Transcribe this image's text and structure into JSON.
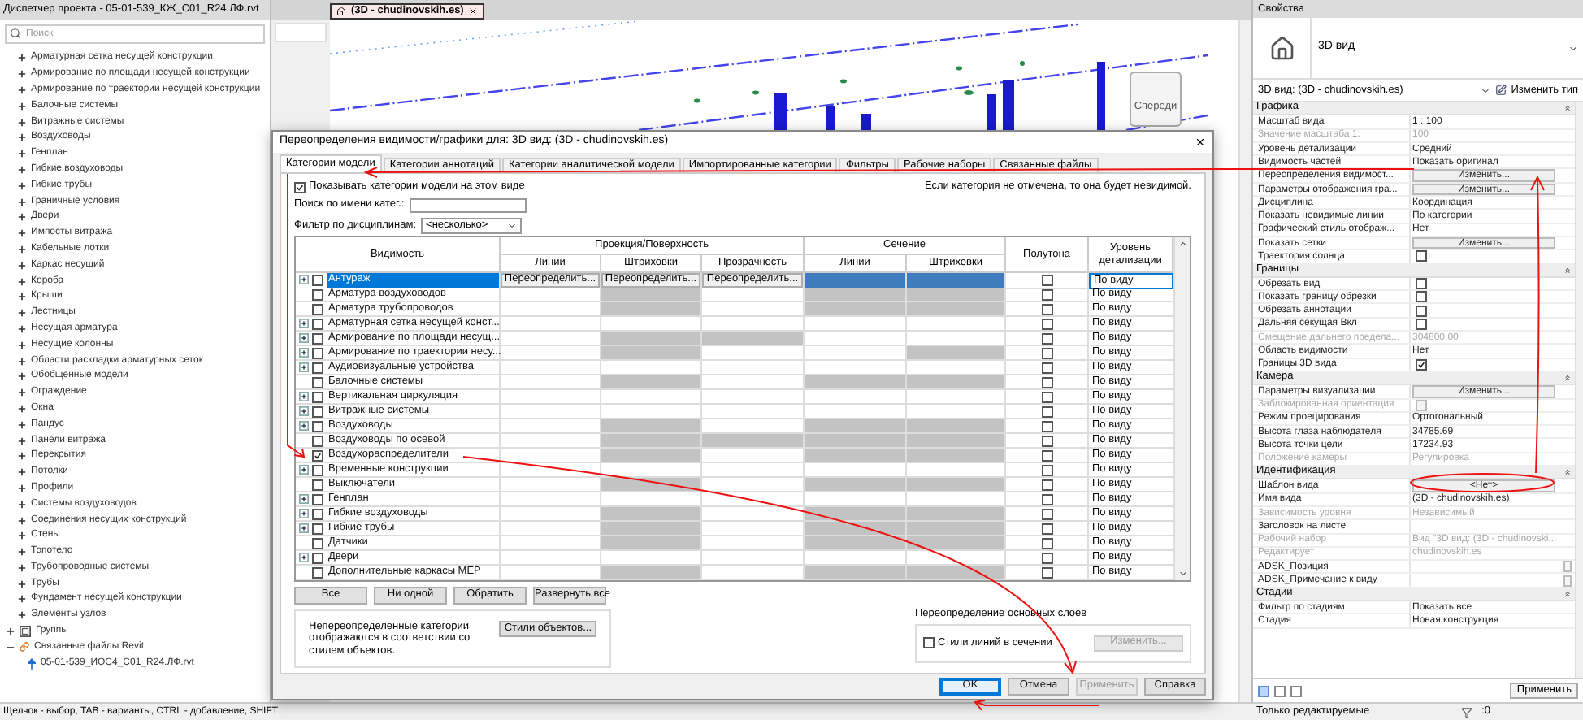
{
  "left_panel": {
    "title": "Диспетчер проекта - 05-01-539_КЖ_С01_R24.ЛФ.rvt",
    "search": {
      "placeholder": "Поиск"
    },
    "tree": [
      {
        "label": "Арматурная сетка несущей конструкции",
        "kind": "category",
        "expanded": false
      },
      {
        "label": "Армирование по площади несущей конструкции",
        "kind": "category",
        "expanded": false
      },
      {
        "label": "Армирование по траектории несущей конструкции",
        "kind": "category",
        "expanded": false
      },
      {
        "label": "Балочные системы",
        "kind": "category",
        "expanded": false
      },
      {
        "label": "Витражные системы",
        "kind": "category",
        "expanded": false
      },
      {
        "label": "Воздуховоды",
        "kind": "category",
        "expanded": false
      },
      {
        "label": "Генплан",
        "kind": "category",
        "expanded": false
      },
      {
        "label": "Гибкие воздуховоды",
        "kind": "category",
        "expanded": false
      },
      {
        "label": "Гибкие трубы",
        "kind": "category",
        "expanded": false
      },
      {
        "label": "Граничные условия",
        "kind": "category",
        "expanded": false
      },
      {
        "label": "Двери",
        "kind": "category",
        "expanded": false
      },
      {
        "label": "Импосты витража",
        "kind": "category",
        "expanded": false
      },
      {
        "label": "Кабельные лотки",
        "kind": "category",
        "expanded": false
      },
      {
        "label": "Каркас несущий",
        "kind": "category",
        "expanded": false
      },
      {
        "label": "Короба",
        "kind": "category",
        "expanded": false
      },
      {
        "label": "Крыши",
        "kind": "category",
        "expanded": false
      },
      {
        "label": "Лестницы",
        "kind": "category",
        "expanded": false
      },
      {
        "label": "Несущая арматура",
        "kind": "category",
        "expanded": false
      },
      {
        "label": "Несущие колонны",
        "kind": "category",
        "expanded": false
      },
      {
        "label": "Области раскладки арматурных сеток",
        "kind": "category",
        "expanded": false
      },
      {
        "label": "Обобщенные модели",
        "kind": "category",
        "expanded": false
      },
      {
        "label": "Ограждение",
        "kind": "category",
        "expanded": false
      },
      {
        "label": "Окна",
        "kind": "category",
        "expanded": false
      },
      {
        "label": "Пандус",
        "kind": "category",
        "expanded": false
      },
      {
        "label": "Панели витража",
        "kind": "category",
        "expanded": false
      },
      {
        "label": "Перекрытия",
        "kind": "category",
        "expanded": false
      },
      {
        "label": "Потолки",
        "kind": "category",
        "expanded": false
      },
      {
        "label": "Профили",
        "kind": "category",
        "expanded": false
      },
      {
        "label": "Системы воздуховодов",
        "kind": "category",
        "expanded": false
      },
      {
        "label": "Соединения несущих конструкций",
        "kind": "category",
        "expanded": false
      },
      {
        "label": "Стены",
        "kind": "category",
        "expanded": false
      },
      {
        "label": "Топотело",
        "kind": "category",
        "expanded": false
      },
      {
        "label": "Трубопроводные системы",
        "kind": "category",
        "expanded": false
      },
      {
        "label": "Трубы",
        "kind": "category",
        "expanded": false
      },
      {
        "label": "Фундамент несущей конструкции",
        "kind": "category",
        "expanded": false
      },
      {
        "label": "Элементы узлов",
        "kind": "category",
        "expanded": false
      },
      {
        "label": "Группы",
        "kind": "group",
        "expanded": false
      },
      {
        "label": "Связанные файлы Revit",
        "kind": "links",
        "expanded": true,
        "children": [
          {
            "label": "05-01-539_ИОС4_С01_R24.ЛФ.rvt",
            "kind": "file"
          }
        ]
      }
    ]
  },
  "view": {
    "tab": "(3D - chudinovskih.es)",
    "cube_label": "Спереди"
  },
  "dialog": {
    "title": "Переопределения видимости/графики для: 3D вид: (3D - chudinovskih.es)",
    "tabs": [
      {
        "label": "Категории модели",
        "selected": true
      },
      {
        "label": "Категории аннотаций",
        "selected": false
      },
      {
        "label": "Категории аналитической модели",
        "selected": false
      },
      {
        "label": "Импортированные категории",
        "selected": false
      },
      {
        "label": "Фильтры",
        "selected": false
      },
      {
        "label": "Рабочие наборы",
        "selected": false
      },
      {
        "label": "Связанные файлы",
        "selected": false
      }
    ],
    "show_categories": {
      "label": "Показывать категории модели на этом виде",
      "checked": true
    },
    "hint": "Если категория не отмечена, то она будет невидимой.",
    "search": {
      "label": "Поиск по имени катег.:"
    },
    "discipline": {
      "label": "Фильтр по дисциплинам:",
      "value": "<несколько>"
    },
    "table": {
      "visibility_header": "Видимость",
      "projection_header": "Проекция/Поверхность",
      "projection_columns": [
        "Линии",
        "Штриховки",
        "Прозрачность"
      ],
      "section_header": "Сечение",
      "section_columns": [
        "Линии",
        "Штриховки"
      ],
      "halftone_header": "Полутона",
      "detail_header": "Уровень детализации",
      "rows": [
        {
          "name": "Антураж",
          "expandable": true,
          "visible": false,
          "selected": true,
          "greyed": [
            false,
            false,
            false,
            true,
            true
          ],
          "overrides": [
            "Переопределить...",
            "Переопределить...",
            "Переопределить..."
          ],
          "halftone": false,
          "detail": "По виду"
        },
        {
          "name": "Арматура воздуховодов",
          "expandable": false,
          "visible": false,
          "selected": false,
          "greyed": [
            false,
            true,
            false,
            true,
            true
          ],
          "halftone": false,
          "detail": "По виду"
        },
        {
          "name": "Арматура трубопроводов",
          "expandable": false,
          "visible": false,
          "selected": false,
          "greyed": [
            false,
            true,
            false,
            true,
            true
          ],
          "halftone": false,
          "detail": "По виду"
        },
        {
          "name": "Арматурная сетка несущей конст...",
          "expandable": true,
          "visible": false,
          "selected": false,
          "greyed": [
            false,
            false,
            false,
            false,
            false
          ],
          "halftone": false,
          "detail": "По виду"
        },
        {
          "name": "Армирование по площади несущ...",
          "expandable": true,
          "visible": false,
          "selected": false,
          "greyed": [
            false,
            true,
            true,
            false,
            false
          ],
          "halftone": false,
          "detail": "По виду"
        },
        {
          "name": "Армирование по траектории несу...",
          "expandable": true,
          "visible": false,
          "selected": false,
          "greyed": [
            false,
            true,
            false,
            false,
            true
          ],
          "halftone": false,
          "detail": "По виду"
        },
        {
          "name": "Аудиовизуальные устройства",
          "expandable": true,
          "visible": false,
          "selected": false,
          "greyed": [
            false,
            false,
            false,
            false,
            false
          ],
          "halftone": false,
          "detail": "По виду"
        },
        {
          "name": "Балочные системы",
          "expandable": false,
          "visible": false,
          "selected": false,
          "greyed": [
            false,
            true,
            false,
            true,
            true
          ],
          "halftone": false,
          "detail": "По виду"
        },
        {
          "name": "Вертикальная циркуляция",
          "expandable": true,
          "visible": false,
          "selected": false,
          "greyed": [
            false,
            false,
            false,
            false,
            false
          ],
          "halftone": false,
          "detail": "По виду"
        },
        {
          "name": "Витражные системы",
          "expandable": true,
          "visible": false,
          "selected": false,
          "greyed": [
            false,
            false,
            false,
            false,
            false
          ],
          "halftone": false,
          "detail": "По виду"
        },
        {
          "name": "Воздуховоды",
          "expandable": true,
          "visible": false,
          "selected": false,
          "greyed": [
            false,
            true,
            false,
            true,
            true
          ],
          "halftone": false,
          "detail": "По виду"
        },
        {
          "name": "Воздуховоды по осевой",
          "expandable": false,
          "visible": false,
          "selected": false,
          "greyed": [
            false,
            true,
            true,
            true,
            true
          ],
          "halftone": false,
          "detail": "По виду"
        },
        {
          "name": "Воздухораспределители",
          "expandable": false,
          "visible": true,
          "selected": false,
          "greyed": [
            false,
            true,
            false,
            true,
            true
          ],
          "halftone": false,
          "detail": "По виду"
        },
        {
          "name": "Временные конструкции",
          "expandable": true,
          "visible": false,
          "selected": false,
          "greyed": [
            false,
            false,
            false,
            false,
            false
          ],
          "halftone": false,
          "detail": "По виду"
        },
        {
          "name": "Выключатели",
          "expandable": false,
          "visible": false,
          "selected": false,
          "greyed": [
            false,
            true,
            false,
            true,
            true
          ],
          "halftone": false,
          "detail": "По виду"
        },
        {
          "name": "Генплан",
          "expandable": true,
          "visible": false,
          "selected": false,
          "greyed": [
            false,
            false,
            false,
            false,
            false
          ],
          "halftone": false,
          "detail": "По виду"
        },
        {
          "name": "Гибкие воздуховоды",
          "expandable": true,
          "visible": false,
          "selected": false,
          "greyed": [
            false,
            true,
            false,
            true,
            true
          ],
          "halftone": false,
          "detail": "По виду"
        },
        {
          "name": "Гибкие трубы",
          "expandable": true,
          "visible": false,
          "selected": false,
          "greyed": [
            false,
            true,
            false,
            true,
            true
          ],
          "halftone": false,
          "detail": "По виду"
        },
        {
          "name": "Датчики",
          "expandable": false,
          "visible": false,
          "selected": false,
          "greyed": [
            false,
            true,
            false,
            true,
            true
          ],
          "halftone": false,
          "detail": "По виду"
        },
        {
          "name": "Двери",
          "expandable": true,
          "visible": false,
          "selected": false,
          "greyed": [
            false,
            false,
            false,
            false,
            false
          ],
          "halftone": false,
          "detail": "По виду"
        },
        {
          "name": "Дополнительные каркасы MEP",
          "expandable": false,
          "visible": false,
          "selected": false,
          "greyed": [
            false,
            true,
            false,
            true,
            true
          ],
          "halftone": false,
          "detail": "По виду"
        }
      ]
    },
    "selection_buttons": [
      "Все",
      "Ни одной",
      "Обратить",
      "Развернуть все"
    ],
    "object_styles": {
      "text": "Непереопределенные категории отображаются в соответствии со стилем объектов.",
      "button": "Стили объектов..."
    },
    "host_layers": {
      "title": "Переопределение основных слоев",
      "checkbox": {
        "label": "Стили линий в сечении",
        "checked": false
      },
      "button": {
        "label": "Изменить...",
        "disabled": true
      }
    },
    "footer_buttons": [
      {
        "label": "OK",
        "kind": "default"
      },
      {
        "label": "Отмена",
        "kind": "normal"
      },
      {
        "label": "Применить",
        "kind": "disabled"
      },
      {
        "label": "Справка",
        "kind": "normal"
      }
    ]
  },
  "properties": {
    "title": "Свойства",
    "type_name": "3D вид",
    "selector": "3D вид: (3D - chudinovskih.es)",
    "edit_type": "Изменить тип",
    "sections": [
      {
        "title": "Графика",
        "rows": [
          {
            "label": "Масштаб вида",
            "kind": "text",
            "value": "1 : 100",
            "disabled": false
          },
          {
            "label": "Значение масштаба  1:",
            "kind": "text",
            "value": "100",
            "disabled": true
          },
          {
            "label": "Уровень детализации",
            "kind": "text",
            "value": "Средний",
            "disabled": false
          },
          {
            "label": "Видимость частей",
            "kind": "text",
            "value": "Показать оригинал",
            "disabled": false
          },
          {
            "label": "Переопределения видимост...",
            "kind": "button",
            "value": "Изменить...",
            "disabled": false
          },
          {
            "label": "Параметры отображения гра...",
            "kind": "button",
            "value": "Изменить...",
            "disabled": false
          },
          {
            "label": "Дисциплина",
            "kind": "text",
            "value": "Координация",
            "disabled": false
          },
          {
            "label": "Показать невидимые линии",
            "kind": "text",
            "value": "По категории",
            "disabled": false
          },
          {
            "label": "Графический стиль отображ...",
            "kind": "text",
            "value": "Нет",
            "disabled": false
          },
          {
            "label": "Показать сетки",
            "kind": "button",
            "value": "Изменить...",
            "disabled": false
          },
          {
            "label": "Траектория солнца",
            "kind": "checkbox",
            "checked": false,
            "disabled": false
          }
        ]
      },
      {
        "title": "Границы",
        "rows": [
          {
            "label": "Обрезать вид",
            "kind": "checkbox",
            "checked": false,
            "disabled": false
          },
          {
            "label": "Показать границу обрезки",
            "kind": "checkbox",
            "checked": false,
            "disabled": false
          },
          {
            "label": "Обрезать аннотации",
            "kind": "checkbox",
            "checked": false,
            "disabled": false
          },
          {
            "label": "Дальняя секущая Вкл",
            "kind": "checkbox",
            "checked": false,
            "disabled": false
          },
          {
            "label": "Смещение дальнего предела...",
            "kind": "text",
            "value": "304800.00",
            "disabled": true
          },
          {
            "label": "Область видимости",
            "kind": "text",
            "value": "Нет",
            "disabled": false
          },
          {
            "label": "Границы 3D вида",
            "kind": "checkbox",
            "checked": true,
            "disabled": false
          }
        ]
      },
      {
        "title": "Камера",
        "rows": [
          {
            "label": "Параметры визуализации",
            "kind": "button",
            "value": "Изменить...",
            "disabled": false
          },
          {
            "label": "Заблокированная ориентация",
            "kind": "checkbox",
            "checked": false,
            "disabled": true
          },
          {
            "label": "Режим проецирования",
            "kind": "text",
            "value": "Ортогональный",
            "disabled": false
          },
          {
            "label": "Высота глаза наблюдателя",
            "kind": "text",
            "value": "34785.69",
            "disabled": false
          },
          {
            "label": "Высота точки цели",
            "kind": "text",
            "value": "17234.93",
            "disabled": false
          },
          {
            "label": "Положение камеры",
            "kind": "text",
            "value": "Регулировка",
            "disabled": true
          }
        ]
      },
      {
        "title": "Идентификация",
        "rows": [
          {
            "label": "Шаблон вида",
            "kind": "button",
            "value": "<Нет>",
            "disabled": false
          },
          {
            "label": "Имя вида",
            "kind": "text",
            "value": "(3D - chudinovskih.es)",
            "disabled": false
          },
          {
            "label": "Зависимость уровня",
            "kind": "text",
            "value": "Независимый",
            "disabled": true
          },
          {
            "label": "Заголовок на листе",
            "kind": "text",
            "disabled": false
          },
          {
            "label": "Рабочий набор",
            "kind": "text",
            "value": "Вид \"3D вид: (3D - chudinovski...",
            "disabled": true
          },
          {
            "label": "Редактирует",
            "kind": "text",
            "value": "chudinovskih.es",
            "disabled": true
          },
          {
            "label": "ADSK_Позиция",
            "kind": "edit",
            "disabled": false
          },
          {
            "label": "ADSK_Примечание к виду",
            "kind": "edit",
            "disabled": false
          }
        ]
      },
      {
        "title": "Стадии",
        "rows": [
          {
            "label": "Фильтр по стадиям",
            "kind": "text",
            "value": "Показать все",
            "disabled": false
          },
          {
            "label": "Стадия",
            "kind": "text",
            "value": "Новая конструкция",
            "disabled": false
          }
        ]
      }
    ],
    "apply": "Применить"
  },
  "status_bar": {
    "hint": "Щелчок - выбор, TAB - варианты, CTRL - добавление, SHIFT",
    "filter_label": "Только редактируемые",
    "count": ":0"
  }
}
